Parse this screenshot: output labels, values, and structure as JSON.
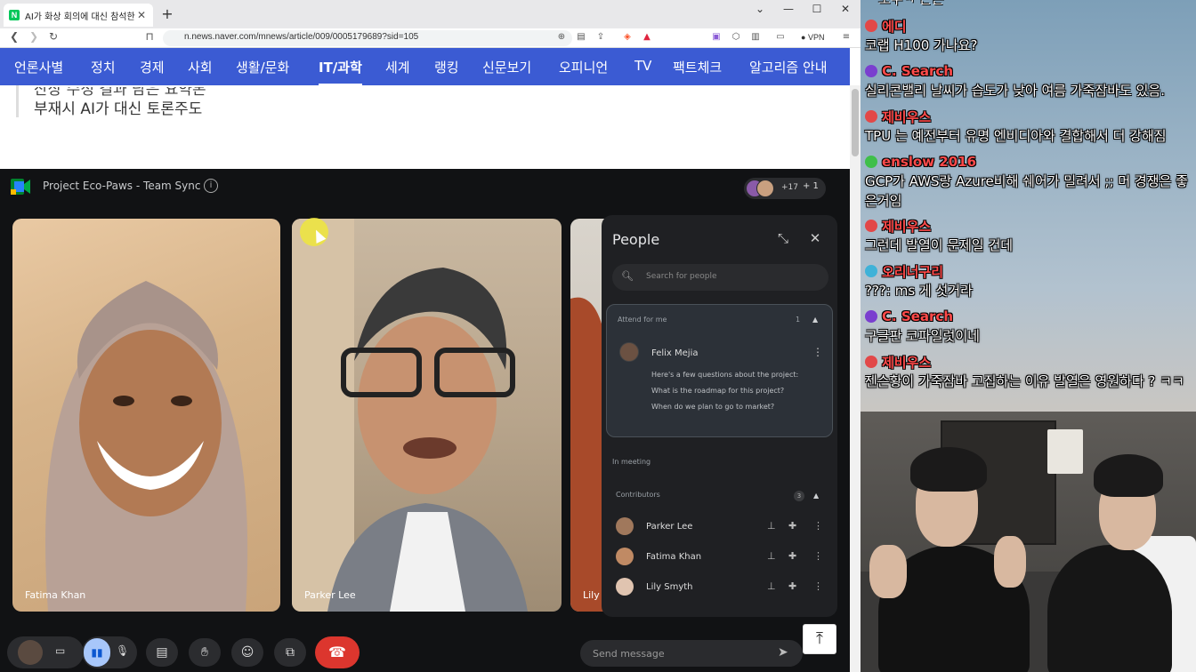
{
  "browser": {
    "tab_title": "AI가 화상 회의에 대신 참석한다",
    "tab_favicon": "N",
    "url": "n.news.naver.com/mnews/article/009/0005179689?sid=105",
    "vpn_label": "VPN"
  },
  "nav": {
    "items": [
      "언론사별",
      "정치",
      "경제",
      "사회",
      "생활/문화",
      "IT/과학",
      "세계",
      "랭킹",
      "신문보기",
      "오피니언",
      "TV",
      "팩트체크",
      "알고리즘 안내"
    ],
    "active_index": 5
  },
  "article": {
    "line_cut": "잔상 수정 결과 담은 요약본",
    "line": "부재시 AI가 대신 토론주도"
  },
  "meet": {
    "title": "Project Eco-Paws - Team Sync",
    "avatar_count": "+17",
    "avatar_plus": "+ 1",
    "tiles": [
      {
        "name": "Fatima Khan"
      },
      {
        "name": "Parker Lee"
      },
      {
        "name": "Lily"
      }
    ],
    "people": {
      "title": "People",
      "search_placeholder": "Search for people",
      "attend_header": "Attend for me",
      "attend_count": "1",
      "attendee": "Felix Mejia",
      "questions": [
        "Here's a few questions about the project:",
        "What is the roadmap for this project?",
        "When do we plan to go to market?"
      ],
      "in_meeting": "In meeting",
      "contributors_header": "Contributors",
      "contributors_count": "3",
      "contributors": [
        "Parker Lee",
        "Fatima Khan",
        "Lily Smyth"
      ]
    },
    "send_placeholder": "Send message"
  },
  "chat": {
    "cut_top": "소우ㅋ 근든",
    "messages": [
      {
        "user": "에디",
        "color": "#ff4a4a",
        "badge_color": "#e24848",
        "text": "코랩 H100 가나요?"
      },
      {
        "user": "C. Search",
        "color": "#ff4a4a",
        "badge_color": "#7a3fcf",
        "text": "실리콘밸리 날씨가 습도가 낮아 여름 가죽잠바도 있음."
      },
      {
        "user": "제비우스",
        "color": "#ff4a4a",
        "badge_color": "#e24848",
        "text": "TPU 는 예전부터 유명 엔비디아와 결합해서 더 강해짐"
      },
      {
        "user": "enslow 2016",
        "color": "#ff4a4a",
        "badge_color": "#3fbf4a",
        "text": "GCP가 AWS랑 Azure비해 쉐어가 밀려서 ;; 머 경쟁은 좋은거임"
      },
      {
        "user": "제비우스",
        "color": "#ff4a4a",
        "badge_color": "#e24848",
        "text": "그런데 발열이 문제일 건데"
      },
      {
        "user": "오리너구리",
        "color": "#ff4a4a",
        "badge_color": "#3fb2d8",
        "text": "???: ms 게 섯거라"
      },
      {
        "user": "C. Search",
        "color": "#ff4a4a",
        "badge_color": "#7a3fcf",
        "text": "구글판 코파일럿이네"
      },
      {
        "user": "제비우스",
        "color": "#ff4a4a",
        "badge_color": "#e24848",
        "text": "젠슨황이 가죽잠바 고집하는 이유 발열은 영원하다 ? ㅋㅋ"
      }
    ]
  },
  "icons": {
    "back": "arrow-left-icon",
    "forward": "arrow-right-icon",
    "reload": "reload-icon",
    "bookmark": "bookmark-icon",
    "zoom": "zoom-icon",
    "share": "share-icon",
    "menu": "hamburger-icon",
    "minimize": "minimize-icon",
    "maximize": "maximize-icon",
    "close": "close-icon"
  }
}
